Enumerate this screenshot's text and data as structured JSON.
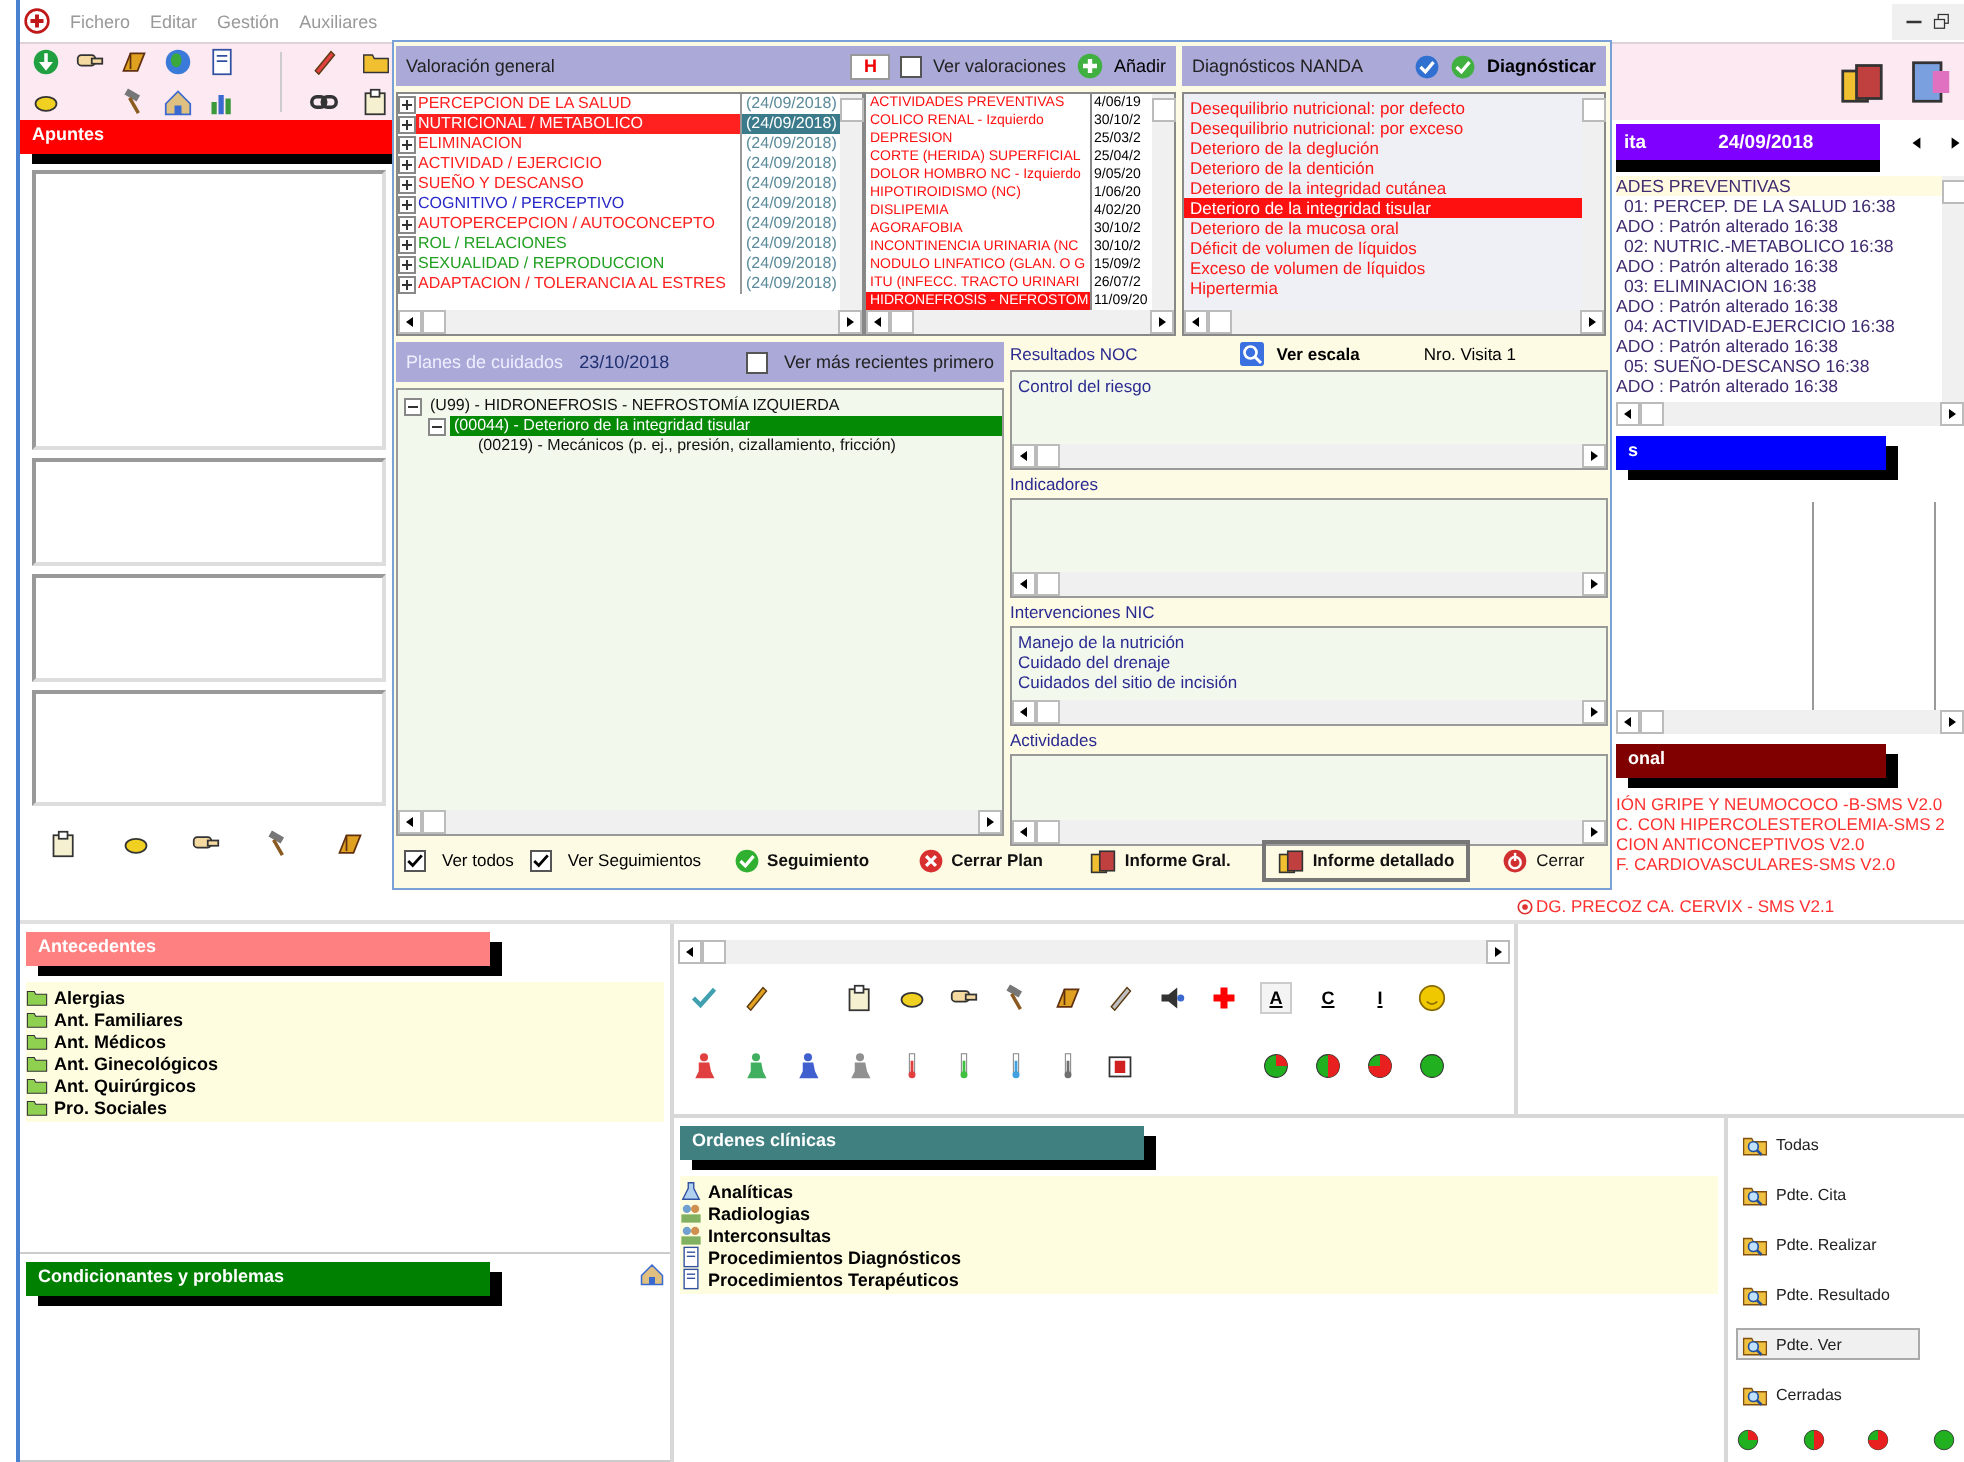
{
  "menu": [
    "Fichero",
    "Editar",
    "Gestión",
    "Auxiliares"
  ],
  "apuntes": {
    "title": "Apuntes"
  },
  "valoracion": {
    "title": "Valoración general",
    "badge": "H",
    "ver_valoraciones": {
      "label": "Ver valoraciones",
      "checked": false
    },
    "add_button": "Añadir",
    "patterns": [
      {
        "label": "PERCEPCION DE LA SALUD",
        "date": "(24/09/2018)",
        "color": "#ff2020",
        "selected": false
      },
      {
        "label": "NUTRICIONAL / METABOLICO",
        "date": "(24/09/2018)",
        "color": "#ff2020",
        "selected": true
      },
      {
        "label": "ELIMINACION",
        "date": "(24/09/2018)",
        "color": "#ff2020",
        "selected": false
      },
      {
        "label": "ACTIVIDAD / EJERCICIO",
        "date": "(24/09/2018)",
        "color": "#ff2020",
        "selected": false
      },
      {
        "label": "SUEÑO Y DESCANSO",
        "date": "(24/09/2018)",
        "color": "#ff2020",
        "selected": false
      },
      {
        "label": "COGNITIVO / PERCEPTIVO",
        "date": "(24/09/2018)",
        "color": "#2828c8",
        "selected": false
      },
      {
        "label": "AUTOPERCEPCION / AUTOCONCEPTO",
        "date": "(24/09/2018)",
        "color": "#ff2020",
        "selected": false
      },
      {
        "label": "ROL / RELACIONES",
        "date": "(24/09/2018)",
        "color": "#22a022",
        "selected": false
      },
      {
        "label": "SEXUALIDAD / REPRODUCCION",
        "date": "(24/09/2018)",
        "color": "#22a022",
        "selected": false
      },
      {
        "label": "ADAPTACION / TOLERANCIA AL ESTRES",
        "date": "(24/09/2018)",
        "color": "#ff2020",
        "selected": false
      }
    ]
  },
  "diagnoses": [
    {
      "name": "ACTIVIDADES PREVENTIVAS",
      "date": "4/06/19",
      "selected": false
    },
    {
      "name": "COLICO RENAL - Izquierdo",
      "date": "30/10/2",
      "selected": false
    },
    {
      "name": "DEPRESION",
      "date": "25/03/2",
      "selected": false
    },
    {
      "name": "CORTE (HERIDA) SUPERFICIAL",
      "date": "25/04/2",
      "selected": false
    },
    {
      "name": "DOLOR HOMBRO NC - Izquierdo",
      "date": "9/05/20",
      "selected": false
    },
    {
      "name": "HIPOTIROIDISMO (NC)",
      "date": "1/06/20",
      "selected": false
    },
    {
      "name": "DISLIPEMIA",
      "date": "4/02/20",
      "selected": false
    },
    {
      "name": "AGORAFOBIA",
      "date": "30/10/2",
      "selected": false
    },
    {
      "name": "INCONTINENCIA URINARIA (NC",
      "date": "30/10/2",
      "selected": false
    },
    {
      "name": "NODULO LINFATICO (GLAN. O G",
      "date": "15/09/2",
      "selected": false
    },
    {
      "name": "ITU (INFECC. TRACTO URINARI",
      "date": "26/07/2",
      "selected": false
    },
    {
      "name": "HIDRONEFROSIS - NEFROSTOM",
      "date": "11/09/20",
      "selected": true
    }
  ],
  "nanda": {
    "title": "Diagnósticos NANDA",
    "button": "Diagnósticar",
    "items": [
      {
        "label": "Desequilibrio nutricional: por defecto",
        "selected": false
      },
      {
        "label": "Desequilibrio nutricional: por exceso",
        "selected": false
      },
      {
        "label": "Deterioro de la deglución",
        "selected": false
      },
      {
        "label": "Deterioro de la dentición",
        "selected": false
      },
      {
        "label": "Deterioro de la integridad cutánea",
        "selected": false
      },
      {
        "label": "Deterioro de la integridad tisular",
        "selected": true
      },
      {
        "label": "Deterioro de la mucosa oral",
        "selected": false
      },
      {
        "label": "Déficit de volumen de líquidos",
        "selected": false
      },
      {
        "label": "Exceso de volumen de líquidos",
        "selected": false
      },
      {
        "label": "Hipertermia",
        "selected": false
      }
    ]
  },
  "plan": {
    "title": "Planes de cuidados",
    "date": "23/10/2018",
    "recent_first": {
      "label": "Ver más recientes primero",
      "checked": false
    },
    "tree": [
      {
        "label": "(U99) - HIDRONEFROSIS - NEFROSTOMÍA IZQUIERDA",
        "selected": false,
        "expanded": true,
        "children": [
          {
            "label": "(00044) - Deterioro de la integridad tisular",
            "selected": true,
            "expanded": true,
            "children": [
              {
                "label": "(00219) - Mecánicos (p. ej., presión, cizallamiento, fricción)",
                "selected": false
              }
            ]
          }
        ]
      }
    ]
  },
  "noc": {
    "title": "Resultados NOC",
    "scale_link": "Ver escala",
    "visit": "Nro. Visita 1",
    "results": [
      "Control del riesgo"
    ],
    "sections": [
      {
        "title": "Indicadores"
      },
      {
        "title": "Intervenciones NIC",
        "items": [
          "Manejo de la nutrición",
          "Cuidado del drenaje",
          "Cuidados del sitio de incisión"
        ]
      },
      {
        "title": "Actividades"
      }
    ]
  },
  "footer": {
    "checks": [
      {
        "label": "Ver todos",
        "checked": true
      },
      {
        "label": "Ver Seguimientos",
        "checked": true
      }
    ],
    "buttons": [
      {
        "label": "Seguimiento",
        "kind": "ok",
        "selected": false
      },
      {
        "label": "Cerrar Plan",
        "kind": "cancel",
        "selected": false
      },
      {
        "label": "Informe Gral.",
        "kind": "report",
        "selected": false
      },
      {
        "label": "Informe detallado",
        "kind": "report",
        "selected": true
      },
      {
        "label": "Cerrar",
        "kind": "close",
        "selected": false
      }
    ]
  },
  "visit": {
    "title": "ita",
    "date": "24/09/2018",
    "items": [
      {
        "text": "ADES PREVENTIVAS",
        "kind": "header"
      },
      {
        "text": "01: PERCEP. DE LA SALUD 16:38",
        "kind": "pattern"
      },
      {
        "text": "ADO : Patrón alterado 16:38",
        "kind": "state"
      },
      {
        "text": "02: NUTRIC.-METABOLICO 16:38",
        "kind": "pattern"
      },
      {
        "text": "ADO : Patrón alterado 16:38",
        "kind": "state"
      },
      {
        "text": "03: ELIMINACION 16:38",
        "kind": "pattern"
      },
      {
        "text": "ADO : Patrón alterado 16:38",
        "kind": "state"
      },
      {
        "text": "04: ACTIVIDAD-EJERCICIO 16:38",
        "kind": "pattern"
      },
      {
        "text": "ADO : Patrón alterado 16:38",
        "kind": "state"
      },
      {
        "text": "05: SUEÑO-DESCANSO 16:38",
        "kind": "pattern"
      },
      {
        "text": "ADO : Patrón alterado 16:38",
        "kind": "state"
      }
    ]
  },
  "blue_panel": {
    "title": "s"
  },
  "protocols": {
    "title": "onal",
    "items": [
      {
        "text": "IÓN GRIPE Y NEUMOCOCO -B-SMS V2.0",
        "kind": "cut"
      },
      {
        "text": "C. CON HIPERCOLESTEROLEMIA-SMS 2",
        "kind": "cut"
      },
      {
        "text": "CION ANTICONCEPTIVOS V2.0",
        "kind": "cut"
      },
      {
        "text": "F. CARDIOVASCULARES-SMS V2.0",
        "kind": "cut"
      },
      {
        "text": "DG. PRECOZ CA. CERVIX - SMS V2.1",
        "kind": "full"
      }
    ]
  },
  "antecedentes": {
    "title": "Antecedentes",
    "items": [
      "Alergias",
      "Ant. Familiares",
      "Ant. Médicos",
      "Ant. Ginecológicos",
      "Ant. Quirúrgicos",
      "Pro. Sociales"
    ]
  },
  "condicionantes": {
    "title": "Condicionantes y problemas"
  },
  "text_tools": [
    {
      "label": "A",
      "selected": true
    },
    {
      "label": "C",
      "selected": false
    },
    {
      "label": "I",
      "selected": false
    }
  ],
  "ordenes": {
    "title": "Ordenes clínicas",
    "items": [
      "Analíticas",
      "Radiologias",
      "Interconsultas",
      "Procedimientos Diagnósticos",
      "Procedimientos Terapéuticos"
    ]
  },
  "filters": [
    {
      "label": "Todas",
      "selected": false
    },
    {
      "label": "Pdte. Cita",
      "selected": false
    },
    {
      "label": "Pdte. Realizar",
      "selected": false
    },
    {
      "label": "Pdte. Resultado",
      "selected": false
    },
    {
      "label": "Pdte. Ver",
      "selected": true
    },
    {
      "label": "Cerradas",
      "selected": false
    }
  ]
}
